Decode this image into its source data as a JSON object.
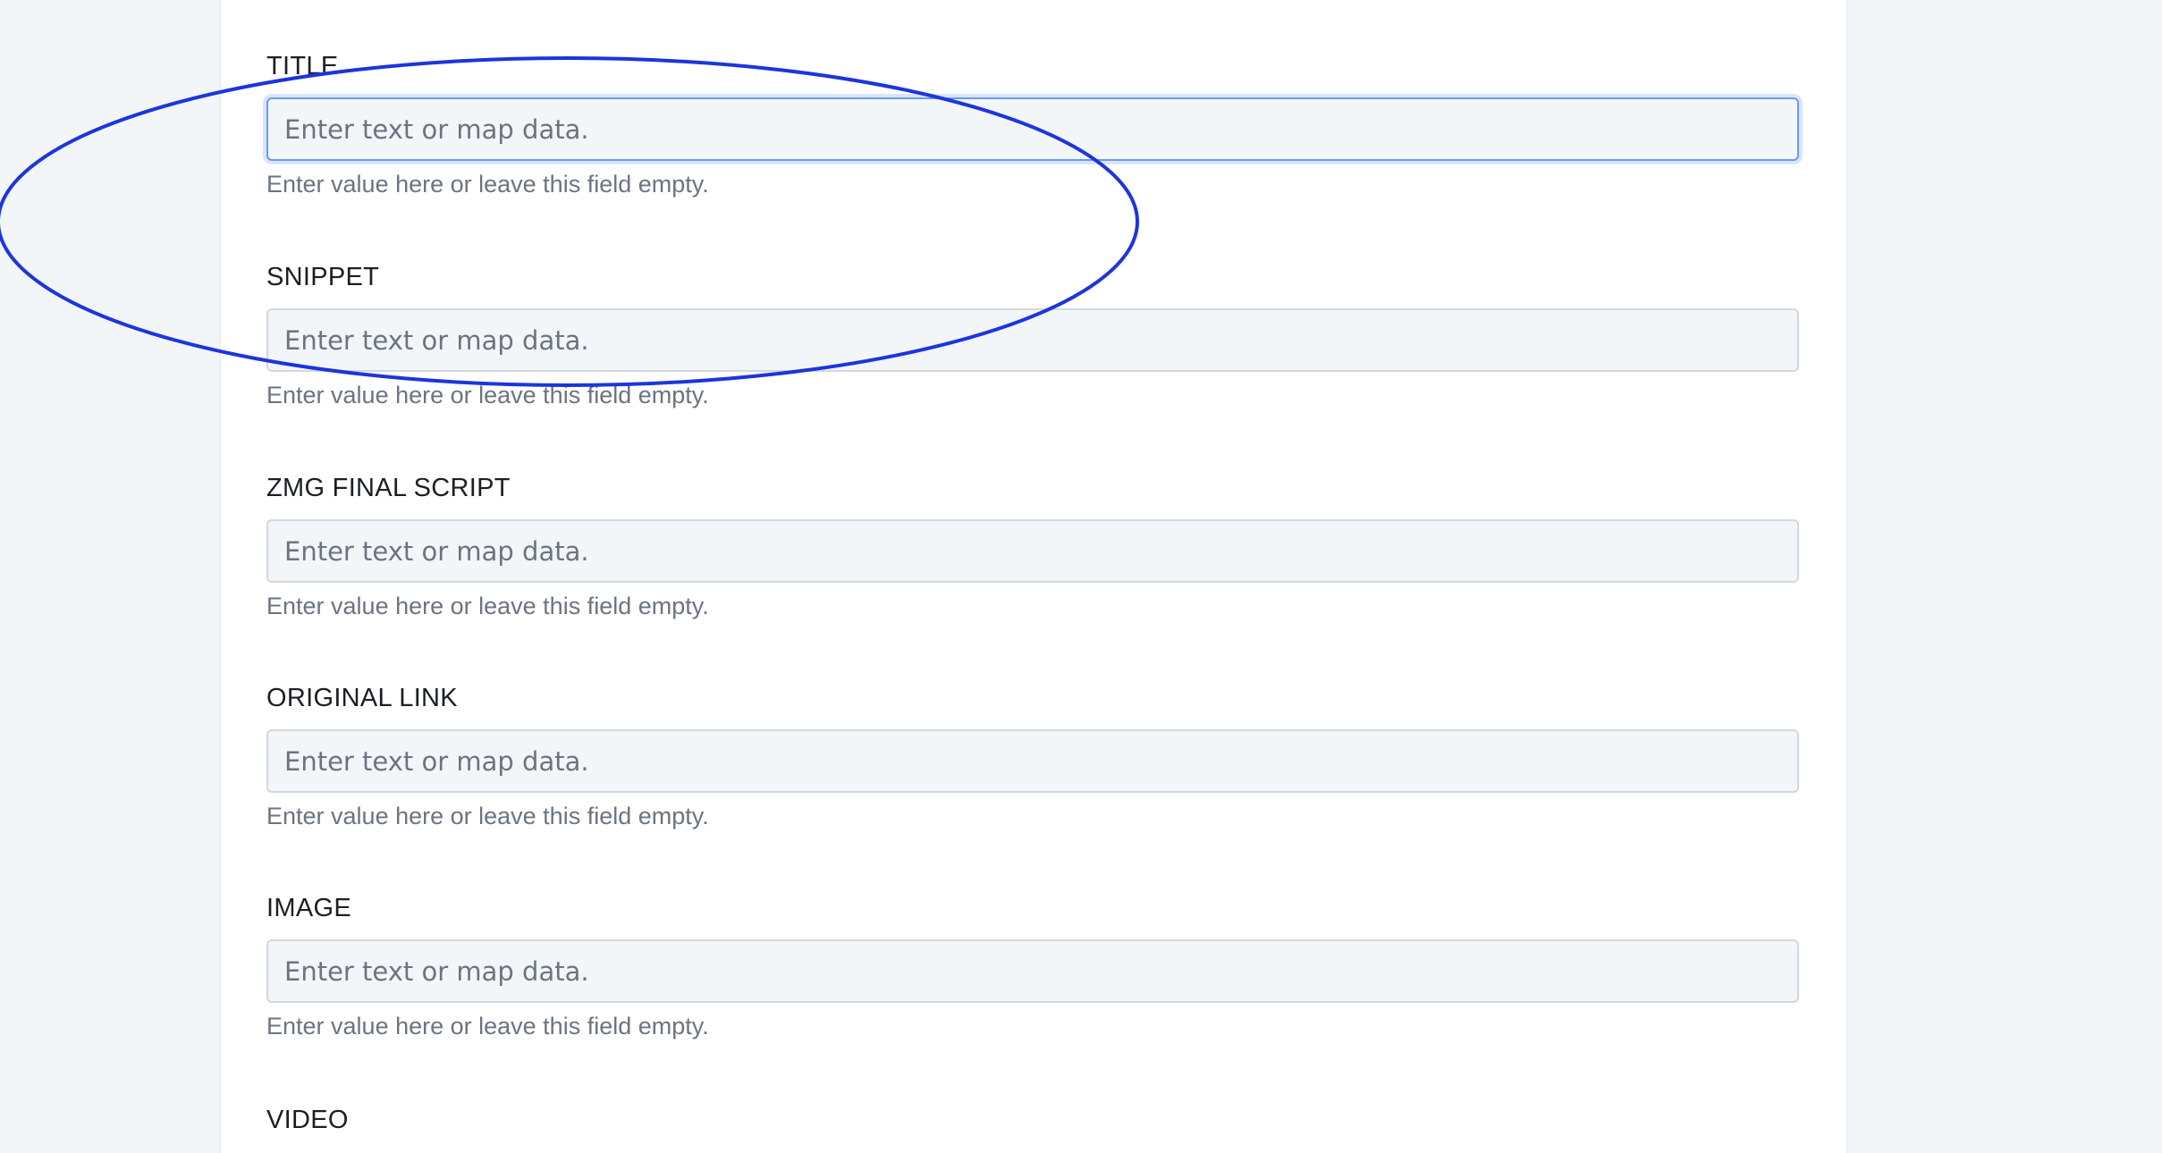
{
  "fields": [
    {
      "label": "TITLE",
      "placeholder": "Enter text or map data.",
      "help": "Enter value here or leave this field empty."
    },
    {
      "label": "SNIPPET",
      "placeholder": "Enter text or map data.",
      "help": "Enter value here or leave this field empty."
    },
    {
      "label": "ZMG FINAL SCRIPT",
      "placeholder": "Enter text or map data.",
      "help": "Enter value here or leave this field empty."
    },
    {
      "label": "ORIGINAL LINK",
      "placeholder": "Enter text or map data.",
      "help": "Enter value here or leave this field empty."
    },
    {
      "label": "IMAGE",
      "placeholder": "Enter text or map data.",
      "help": "Enter value here or leave this field empty."
    },
    {
      "label": "VIDEO"
    }
  ],
  "annotation": {
    "stroke_color": "#1c35dc"
  },
  "colors": {
    "page_background": "#f3f6f9",
    "panel_background": "#ffffff",
    "input_background": "#f3f6f9",
    "input_border": "#d3d8de",
    "focus_border": "#6a9bf0",
    "label_text": "#1b1f24",
    "help_text": "#6b7480"
  }
}
